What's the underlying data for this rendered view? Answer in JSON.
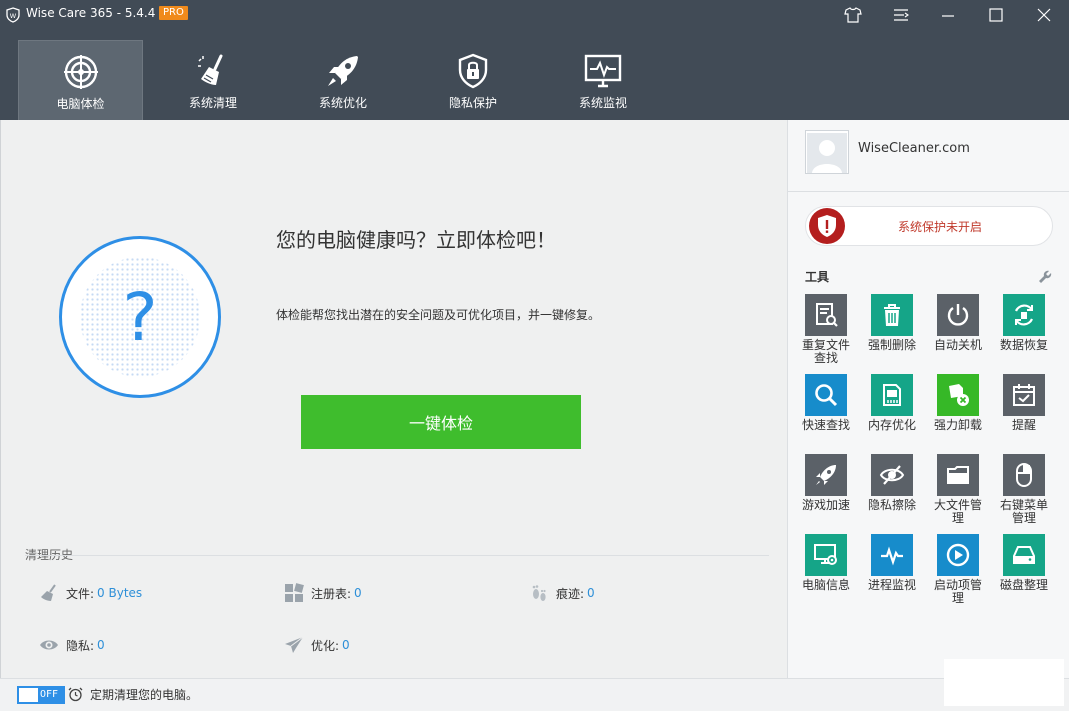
{
  "app": {
    "title": "Wise Care 365 - 5.4.4",
    "badge": "PRO"
  },
  "nav": {
    "items": [
      {
        "label": "电脑体检",
        "icon": "radar-scan-icon",
        "active": true
      },
      {
        "label": "系统清理",
        "icon": "broom-icon"
      },
      {
        "label": "系统优化",
        "icon": "rocket-icon"
      },
      {
        "label": "隐私保护",
        "icon": "padlock-shield-icon"
      },
      {
        "label": "系统监视",
        "icon": "monitor-pulse-icon"
      }
    ]
  },
  "main": {
    "headline": "您的电脑健康吗？立即体检吧！",
    "description": "体检能帮您找出潜在的安全问题及可优化项目，并一键修复。",
    "status_symbol": "?",
    "scan_button": "一键体检",
    "history": {
      "title": "清理历史",
      "items": [
        {
          "label": "文件:",
          "value": "0 Bytes",
          "icon": "broom-icon"
        },
        {
          "label": "注册表:",
          "value": "0",
          "icon": "registry-blocks-icon"
        },
        {
          "label": "痕迹:",
          "value": "0",
          "icon": "footprints-icon"
        },
        {
          "label": "隐私:",
          "value": "0",
          "icon": "eye-icon"
        },
        {
          "label": "优化:",
          "value": "0",
          "icon": "paper-plane-icon"
        }
      ]
    }
  },
  "sidebar": {
    "account": "WiseCleaner.com",
    "protection": "系统保护未开启",
    "tools_title": "工具",
    "tools": [
      {
        "label": "重复文件查找",
        "color": "#5b6168",
        "icon": "document-search-icon"
      },
      {
        "label": "强制删除",
        "color": "#15a588",
        "icon": "trash-icon"
      },
      {
        "label": "自动关机",
        "color": "#5b6168",
        "icon": "power-icon"
      },
      {
        "label": "数据恢复",
        "color": "#15a588",
        "icon": "recover-icon"
      },
      {
        "label": "快速查找",
        "color": "#178ccb",
        "icon": "magnifier-icon"
      },
      {
        "label": "内存优化",
        "color": "#15a588",
        "icon": "memory-chip-icon"
      },
      {
        "label": "强力卸载",
        "color": "#36b827",
        "icon": "uninstall-icon"
      },
      {
        "label": "提醒",
        "color": "#5b6168",
        "icon": "calendar-check-icon"
      },
      {
        "label": "游戏加速",
        "color": "#5b6168",
        "icon": "rocket-icon"
      },
      {
        "label": "隐私擦除",
        "color": "#5b6168",
        "icon": "eye-slash-icon"
      },
      {
        "label": "大文件管理",
        "color": "#5b6168",
        "icon": "folder-icon"
      },
      {
        "label": "右键菜单管理",
        "color": "#5b6168",
        "icon": "mouse-icon"
      },
      {
        "label": "电脑信息",
        "color": "#15a588",
        "icon": "monitor-gear-icon"
      },
      {
        "label": "进程监视",
        "color": "#178ccb",
        "icon": "pulse-icon"
      },
      {
        "label": "启动项管理",
        "color": "#178ccb",
        "icon": "play-circle-icon"
      },
      {
        "label": "磁盘整理",
        "color": "#15a588",
        "icon": "disk-drive-icon"
      }
    ]
  },
  "footer": {
    "toggle": "OFF",
    "text": "定期清理您的电脑。"
  }
}
